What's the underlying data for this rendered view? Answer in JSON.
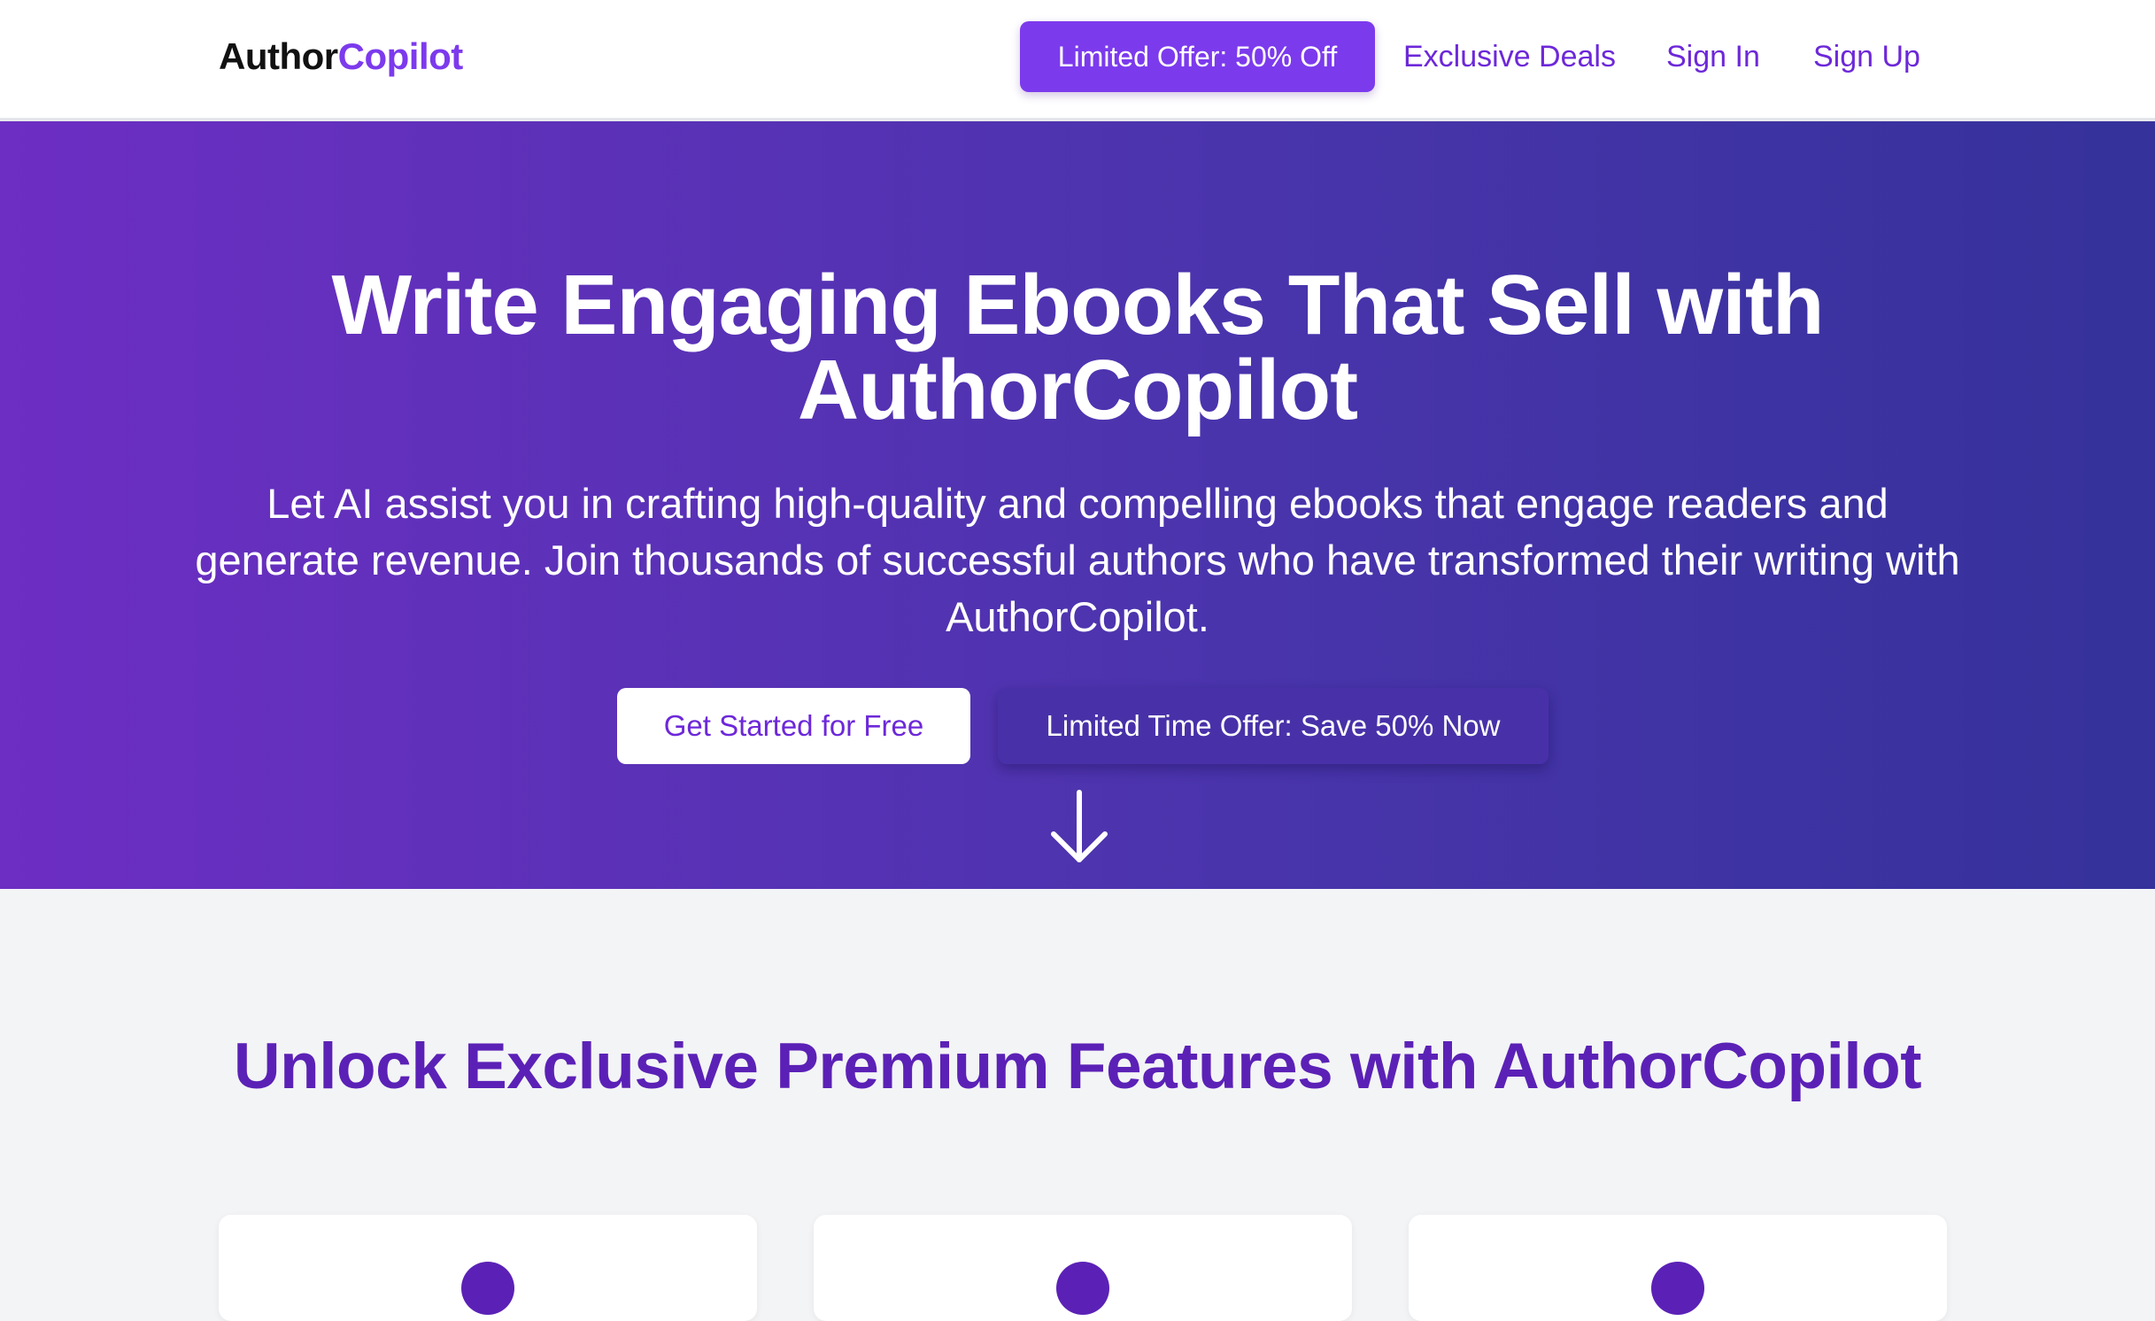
{
  "brand": {
    "logo_part1": "Author",
    "logo_part2": "Copilot"
  },
  "nav": {
    "offer_button": "Limited Offer: 50% Off",
    "deals_link": "Exclusive Deals",
    "signin_link": "Sign In",
    "signup_link": "Sign Up"
  },
  "hero": {
    "title": "Write Engaging Ebooks That Sell with AuthorCopilot",
    "subtitle": "Let AI assist you in crafting high-quality and compelling ebooks that engage readers and generate revenue. Join thousands of successful authors who have transformed their writing with AuthorCopilot.",
    "primary_button": "Get Started for Free",
    "secondary_button": "Limited Time Offer: Save 50% Now",
    "scroll_icon": "arrow-down-icon"
  },
  "features": {
    "title": "Unlock Exclusive Premium Features with AuthorCopilot",
    "card_icon": "feature-circle-icon"
  },
  "colors": {
    "accent": "#7c3aed",
    "accent_dark": "#5b21b6",
    "hero_gradient_start": "#6d2ec3",
    "hero_gradient_end": "#35329b",
    "page_background": "#f3f4f6"
  }
}
